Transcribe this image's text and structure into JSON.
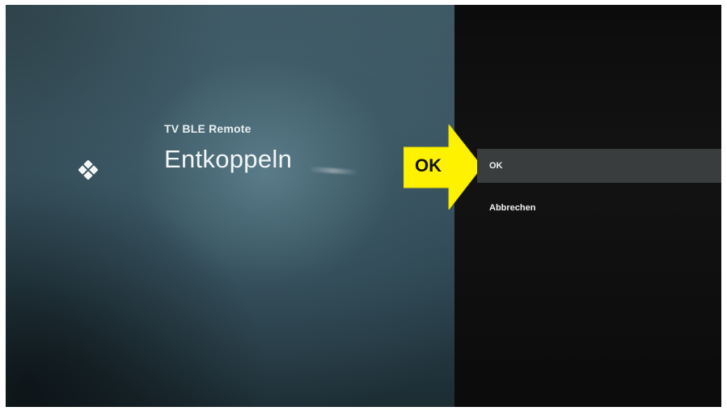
{
  "device": {
    "icon": "gamepad-dpad-icon",
    "name": "TV BLE Remote",
    "action_title": "Entkoppeln"
  },
  "annotation": {
    "label": "OK",
    "color": "#ffef00"
  },
  "dialog": {
    "options": [
      {
        "label": "OK",
        "selected": true
      },
      {
        "label": "Abbrechen",
        "selected": false
      }
    ]
  }
}
